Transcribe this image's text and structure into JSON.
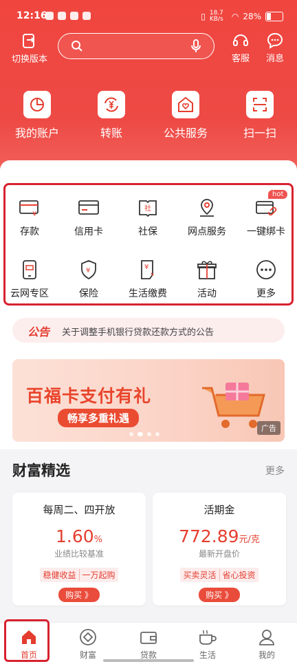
{
  "status": {
    "time": "12:16",
    "net_speed": "18.7 KB/s",
    "battery": "28%"
  },
  "top": {
    "switch_label": "切换版本",
    "search_placeholder": "",
    "service_label": "客服",
    "message_label": "消息"
  },
  "quick_actions": [
    {
      "label": "我的账户",
      "icon": "pie-chart-icon"
    },
    {
      "label": "转账",
      "icon": "yuan-transfer-icon"
    },
    {
      "label": "公共服务",
      "icon": "public-service-icon"
    },
    {
      "label": "扫一扫",
      "icon": "scan-icon"
    }
  ],
  "grid": {
    "items": [
      {
        "label": "存款",
        "icon": "deposit-card-icon"
      },
      {
        "label": "信用卡",
        "icon": "credit-card-icon"
      },
      {
        "label": "社保",
        "icon": "social-security-icon"
      },
      {
        "label": "网点服务",
        "icon": "location-pin-icon"
      },
      {
        "label": "一键绑卡",
        "icon": "link-card-icon"
      },
      {
        "label": "云网专区",
        "icon": "phone-icon"
      },
      {
        "label": "保险",
        "icon": "shield-icon"
      },
      {
        "label": "生活缴费",
        "icon": "bill-icon"
      },
      {
        "label": "活动",
        "icon": "gift-icon"
      },
      {
        "label": "更多",
        "icon": "more-icon"
      }
    ],
    "hot_badge": "hot"
  },
  "notice": {
    "tag": "公告",
    "text": "关于调整手机银行贷款还款方式的公告"
  },
  "banner": {
    "title": "百福卡支付有礼",
    "subtitle": "畅享多重礼遇",
    "ad_label": "广告",
    "current_slide": 2,
    "slide_count": 4
  },
  "wealth": {
    "title": "财富精选",
    "more": "更多",
    "cards": [
      {
        "name": "每周二、四开放",
        "value": "1.60",
        "unit": "%",
        "sub": "业绩比较基准",
        "tag1": "稳健收益",
        "tag2": "一万起购",
        "buy": "购买 》"
      },
      {
        "name": "活期金",
        "value": "772.89",
        "unit": "元/克",
        "sub": "最新开盘价",
        "tag1": "买卖灵活",
        "tag2": "省心投资",
        "buy": "购买 》"
      }
    ]
  },
  "tabs": [
    {
      "label": "首页",
      "active": true
    },
    {
      "label": "财富",
      "active": false
    },
    {
      "label": "贷款",
      "active": false
    },
    {
      "label": "生活",
      "active": false
    },
    {
      "label": "我的",
      "active": false
    }
  ],
  "colors": {
    "brand_red": "#ee4a45",
    "accent_red": "#e33d2f"
  }
}
